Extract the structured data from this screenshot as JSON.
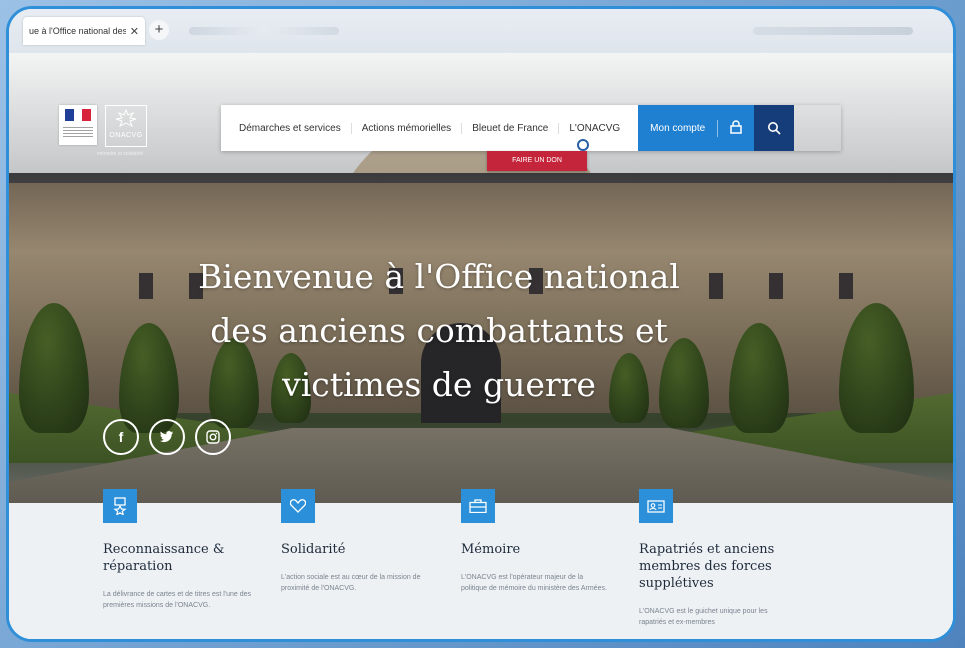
{
  "browser": {
    "tab_title": "ue à l'Office national des",
    "tab_close": "✕",
    "new_tab": "+"
  },
  "header": {
    "onacvg_name": "ONACVG",
    "onacvg_tagline": "mémoire et solidarité",
    "nav_items": [
      "Démarches et services",
      "Actions mémorielles",
      "Bleuet de France",
      "L'ONACVG"
    ],
    "account_label": "Mon compte",
    "donate_label": "FAIRE UN DON"
  },
  "hero": {
    "title_lines": [
      "Bienvenue à l'Office national",
      "des anciens combattants et",
      "victimes de guerre"
    ],
    "socials": [
      {
        "icon": "facebook-icon",
        "glyph": "f"
      },
      {
        "icon": "twitter-icon",
        "glyph": "t"
      },
      {
        "icon": "instagram-icon",
        "glyph": "◎"
      }
    ]
  },
  "cards": [
    {
      "icon": "award-icon",
      "title": "Reconnaissance & réparation",
      "text": "La délivrance de cartes et de titres est l'une des premières missions de l'ONACVG."
    },
    {
      "icon": "heart-icon",
      "title": "Solidarité",
      "text": "L'action sociale est au cœur de la mission de proximité de l'ONACVG."
    },
    {
      "icon": "briefcase-icon",
      "title": "Mémoire",
      "text": "L'ONACVG est l'opérateur majeur de la politique de mémoire du ministère des Armées."
    },
    {
      "icon": "id-card-icon",
      "title": "Rapatriés et anciens membres des forces supplétives",
      "text": "L'ONACVG est le guichet unique pour les rapatriés et ex-membres"
    }
  ],
  "colors": {
    "accent": "#2b8fd9",
    "account": "#1f7fd0",
    "search": "#153d7a",
    "donate": "#c5253a",
    "frame": "#2f8fd8"
  }
}
